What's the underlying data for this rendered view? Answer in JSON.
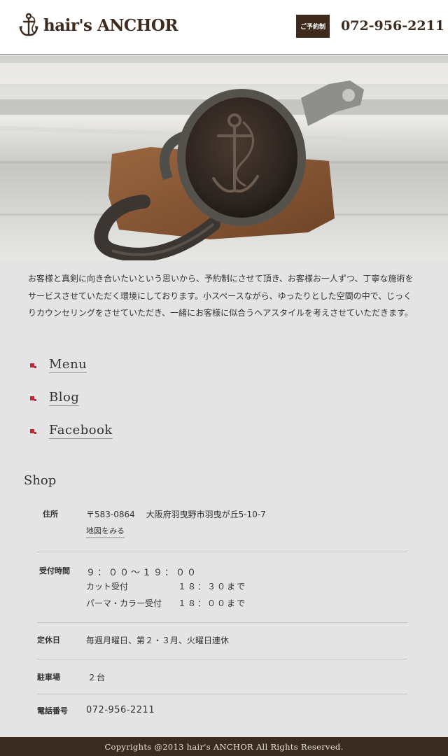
{
  "header": {
    "logo_text": "hair's ANCHOR",
    "reserve_badge": "ご予約制",
    "phone": "072-956-2211"
  },
  "intro": {
    "text": "お客様と真剣に向き合いたいという思いから、予約制にさせて頂き、お客様お一人ずつ、丁寧な施術をサービスさせていただく環境にしております。小スペースながら、ゆったりとした空間の中で、じっくりカウンセリングをさせていただき、一緒にお客様に似合うヘアスタイルを考えさせていただきます。"
  },
  "nav": {
    "items": [
      {
        "label": "Menu"
      },
      {
        "label": "Blog"
      },
      {
        "label": "Facebook"
      }
    ]
  },
  "shop": {
    "title": "Shop",
    "address": {
      "label": "住所",
      "value": "〒583-0864　 大阪府羽曳野市羽曳が丘5-10-7",
      "map_link": "地図をみる"
    },
    "hours": {
      "label": "受付時間",
      "main": "９：００〜１９：００",
      "cut_label": "カット受付",
      "cut_value": "１８：３０まで",
      "perm_label": "パーマ・カラー受付",
      "perm_value": "１８：００まで"
    },
    "closed": {
      "label": "定休日",
      "value": "毎週月曜日、第２・３月、火曜日連休"
    },
    "parking": {
      "label": "駐車場",
      "value": "２台"
    },
    "tel": {
      "label": "電話番号",
      "value": "072-956-2211"
    }
  },
  "footer": {
    "copyright": "Copyrights @2013 hair's ANCHOR All Rights Reserved."
  },
  "colors": {
    "brand_brown": "#3d2b1f",
    "bullet_red": "#c0283a",
    "background": "#e4e4e4"
  }
}
